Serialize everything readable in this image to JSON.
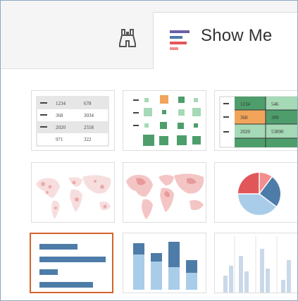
{
  "tabs": {
    "find_icon": "binoculars-icon",
    "show_me": {
      "label": "Show Me",
      "icon": "show-me-bars-icon"
    }
  },
  "text_table": {
    "rows": [
      [
        "1234",
        "678"
      ],
      [
        "368",
        "3034"
      ],
      [
        "2020",
        "2558"
      ],
      [
        "971",
        "322"
      ]
    ]
  },
  "highlight_table": {
    "rows": [
      [
        "1234",
        "546"
      ],
      [
        "368",
        "389"
      ],
      [
        "2020",
        "53890"
      ]
    ]
  },
  "colors": {
    "accent": "#d4622b",
    "bar_blue": "#4e7ca8",
    "bar_light": "#a9cde9",
    "green_dark": "#4e9e6c",
    "green_light": "#a6d9b6",
    "orange": "#f2a45b",
    "red": "#e15759",
    "map_pink": "#f2b8b8"
  },
  "thumbnails": [
    {
      "name": "text-table",
      "selected": false
    },
    {
      "name": "heat-map",
      "selected": false
    },
    {
      "name": "highlight-table",
      "selected": false
    },
    {
      "name": "symbol-map",
      "selected": false
    },
    {
      "name": "filled-map",
      "selected": false
    },
    {
      "name": "pie-chart",
      "selected": false
    },
    {
      "name": "horizontal-bars",
      "selected": true
    },
    {
      "name": "stacked-bars",
      "selected": false
    },
    {
      "name": "side-by-side-bars",
      "selected": false
    }
  ]
}
